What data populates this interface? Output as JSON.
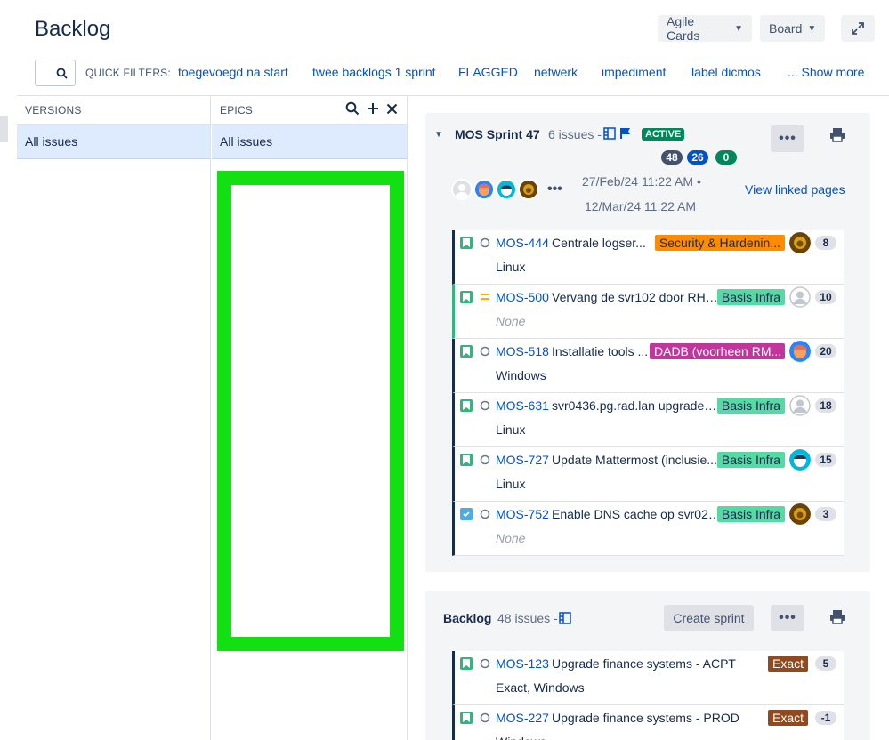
{
  "header": {
    "title": "Backlog",
    "cards_label": "Agile Cards",
    "board_label": "Board"
  },
  "quick_filters": {
    "label": "QUICK FILTERS:",
    "items": [
      "toegevoegd na start",
      "twee backlogs 1 sprint",
      "FLAGGED",
      "netwerk",
      "impediment",
      "label dicmos"
    ],
    "show_more": "... Show more"
  },
  "versions": {
    "heading": "VERSIONS",
    "all": "All issues"
  },
  "epics": {
    "heading": "EPICS",
    "all": "All issues"
  },
  "sprint": {
    "name": "MOS Sprint 47",
    "count": "6 issues",
    "count_sep": "-",
    "status": "ACTIVE",
    "points": [
      {
        "value": "48",
        "color": "#42526e"
      },
      {
        "value": "26",
        "color": "#0052cc"
      },
      {
        "value": "0",
        "color": "#00875a"
      }
    ],
    "start": "27/Feb/24 11:22 AM",
    "dot": "•",
    "end": "12/Mar/24 11:22 AM",
    "view_linked": "View linked pages",
    "issues": [
      {
        "key": "MOS-444",
        "summary": "Centrale logser...",
        "label": "Security & Hardenin...",
        "label_bg": "#ff8b00",
        "label_fg": "#172b4d",
        "estimate": "8",
        "sub": "Linux",
        "sub_none": false,
        "priority": "medium",
        "type": "story",
        "avatar": "lion",
        "border": "dark"
      },
      {
        "key": "MOS-500",
        "summary": "Vervang de svr102 door RHE...",
        "label": "Basis Infra",
        "label_bg": "#57d9a3",
        "label_fg": "#172b4d",
        "estimate": "10",
        "sub": "None",
        "sub_none": true,
        "priority": "equal",
        "type": "story",
        "avatar": "default",
        "border": "green"
      },
      {
        "key": "MOS-518",
        "summary": "Installatie tools ...",
        "label": "DADB (voorheen RM...",
        "label_bg": "#c0369a",
        "label_fg": "#ffffff",
        "estimate": "20",
        "sub": "Windows",
        "sub_none": false,
        "priority": "medium",
        "type": "story",
        "avatar": "orange",
        "border": "dark"
      },
      {
        "key": "MOS-631",
        "summary": "svr0436.pg.rad.lan upgraden...",
        "label": "Basis Infra",
        "label_bg": "#57d9a3",
        "label_fg": "#172b4d",
        "estimate": "18",
        "sub": "Linux",
        "sub_none": false,
        "priority": "medium",
        "type": "story",
        "avatar": "default",
        "border": "dark"
      },
      {
        "key": "MOS-727",
        "summary": "Update Mattermost (inclusie...",
        "label": "Basis Infra",
        "label_bg": "#57d9a3",
        "label_fg": "#172b4d",
        "estimate": "15",
        "sub": "Linux",
        "sub_none": false,
        "priority": "medium",
        "type": "story",
        "avatar": "blue",
        "border": "dark"
      },
      {
        "key": "MOS-752",
        "summary": "Enable DNS cache op svr025...",
        "label": "Basis Infra",
        "label_bg": "#57d9a3",
        "label_fg": "#172b4d",
        "estimate": "3",
        "sub": "None",
        "sub_none": true,
        "priority": "medium",
        "type": "task",
        "avatar": "lion",
        "border": "dark"
      }
    ]
  },
  "backlog": {
    "name": "Backlog",
    "count": "48 issues",
    "count_sep": "-",
    "create_sprint": "Create sprint",
    "issues": [
      {
        "key": "MOS-123",
        "summary": "Upgrade finance systems - ACPT",
        "label": "Exact",
        "label_bg": "#8f4a1f",
        "label_fg": "#ffffff",
        "estimate": "5",
        "sub": "Exact, Windows",
        "sub_none": false,
        "priority": "medium",
        "type": "story",
        "border": "dark"
      },
      {
        "key": "MOS-227",
        "summary": "Upgrade finance systems - PROD",
        "label": "Exact",
        "label_bg": "#8f4a1f",
        "label_fg": "#ffffff",
        "estimate": "-1",
        "sub": "Windows",
        "sub_none": false,
        "priority": "medium",
        "type": "story",
        "border": "dark"
      }
    ]
  }
}
